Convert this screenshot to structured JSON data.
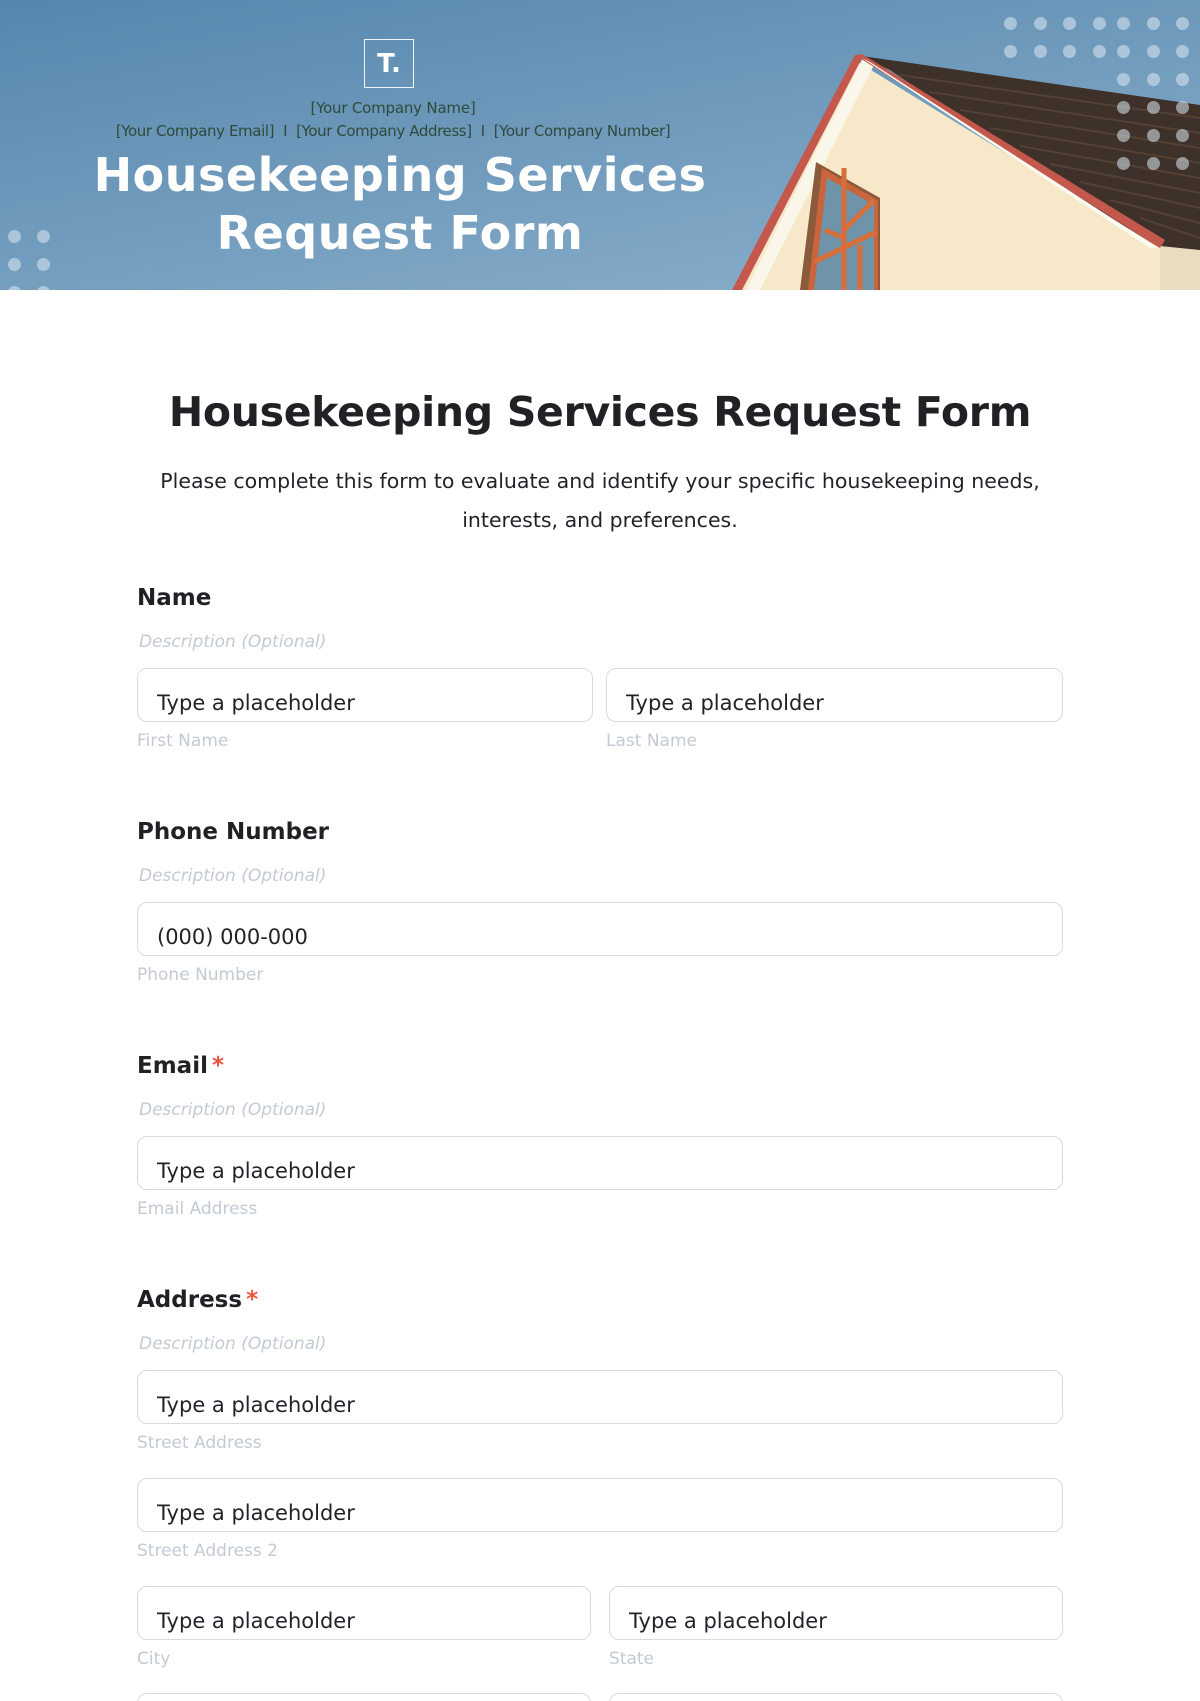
{
  "banner": {
    "logo_text": "T.",
    "company_name": "[Your Company Name]",
    "company_email": "[Your Company Email]",
    "company_address": "[Your Company Address]",
    "company_number": "[Your Company Number]",
    "separator": "I",
    "title_line1": "Housekeeping Services",
    "title_line2": "Request Form",
    "colors": {
      "sky": "#5f8fb4",
      "wall": "#f5e6c4",
      "roof": "#3b2f26",
      "trim": "#c9574a"
    }
  },
  "form": {
    "title": "Housekeeping Services Request Form",
    "intro": "Please complete this form to evaluate and identify your specific housekeeping needs, interests, and preferences.",
    "required_marker": "*",
    "required_color": "#e8553f",
    "fields": [
      {
        "label": "Name",
        "required": false,
        "description": "Description (Optional)",
        "inputs": [
          {
            "value": "Type a placeholder",
            "sublabel": "First Name"
          },
          {
            "value": "Type a placeholder",
            "sublabel": "Last Name"
          }
        ]
      },
      {
        "label": "Phone Number",
        "required": false,
        "description": "Description (Optional)",
        "inputs": [
          {
            "value": "(000) 000-000",
            "sublabel": "Phone Number"
          }
        ]
      },
      {
        "label": "Email",
        "required": true,
        "description": "Description (Optional)",
        "inputs": [
          {
            "value": "Type a placeholder",
            "sublabel": "Email Address"
          }
        ]
      },
      {
        "label": "Address",
        "required": true,
        "description": "Description (Optional)",
        "inputs": [
          {
            "value": "Type a placeholder",
            "sublabel": "Street Address"
          },
          {
            "value": "Type a placeholder",
            "sublabel": "Street Address 2"
          },
          {
            "value": "Type a placeholder",
            "sublabel": "City"
          },
          {
            "value": "Type a placeholder",
            "sublabel": "State"
          }
        ]
      }
    ]
  }
}
